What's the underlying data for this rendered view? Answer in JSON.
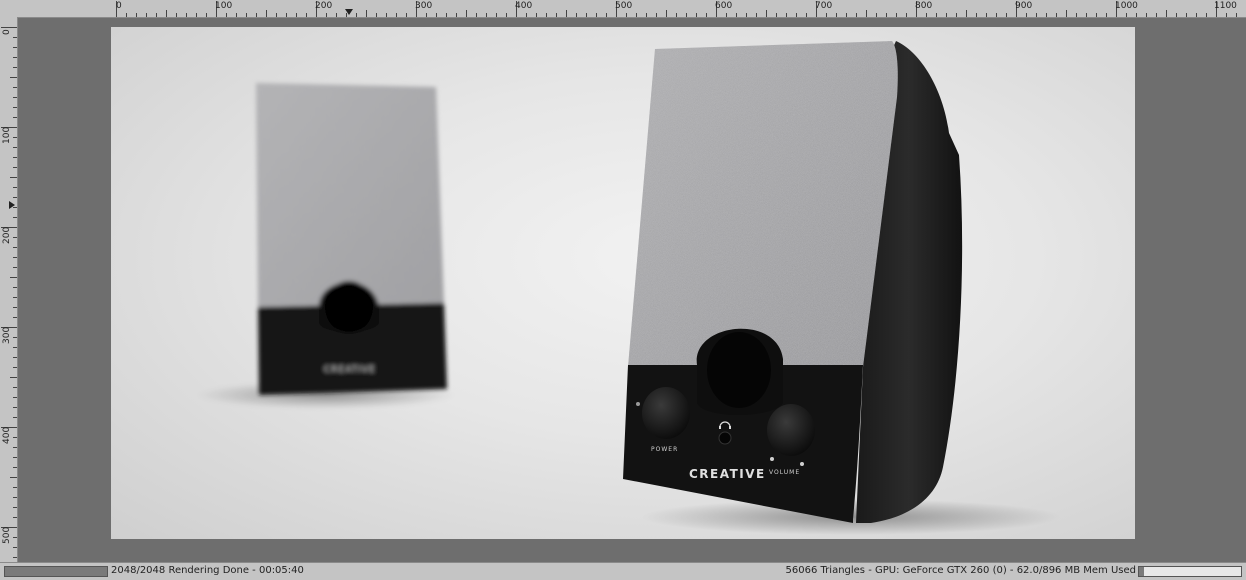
{
  "ruler": {
    "top_labels": [
      "0",
      "100",
      "200",
      "300",
      "400",
      "500",
      "600",
      "700",
      "800",
      "900",
      "1000",
      "1100"
    ],
    "left_labels": [
      "0",
      "100",
      "200",
      "300",
      "400",
      "500"
    ]
  },
  "render": {
    "brand_text": "CREATIVE",
    "power_label": "POWER",
    "volume_label": "VOLUME"
  },
  "status": {
    "render_text": "2048/2048 Rendering Done - 00:05:40",
    "stats_text": "56066 Triangles - GPU: GeForce GTX 260 (0) - 62.0/896 MB Mem Used",
    "left_progress": 1.0,
    "right_progress": 0.05
  }
}
